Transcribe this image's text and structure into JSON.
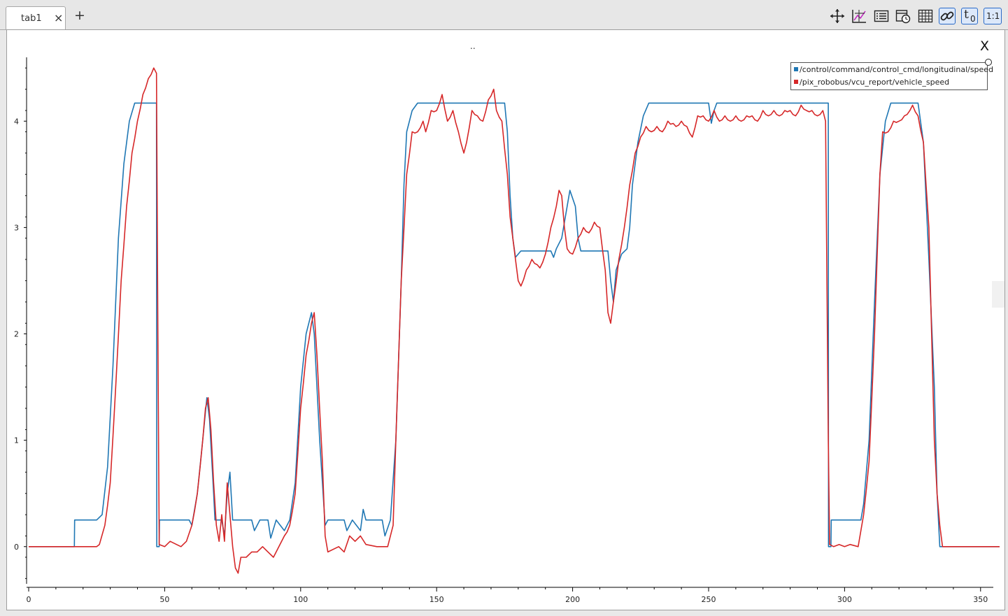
{
  "tabs": [
    {
      "label": "tab1"
    }
  ],
  "add_tab_label": "+",
  "tab_close_label": "×",
  "toolbar": {
    "icons": [
      "move-icon",
      "axis-scale-icon",
      "list-icon",
      "time-icon",
      "grid-icon",
      "link-icon",
      "t0-icon",
      "ratio-icon"
    ],
    "t0_label": "t",
    "t0_sub": "0",
    "ratio_label": "1:1"
  },
  "plot": {
    "title": "..",
    "close_label": "X"
  },
  "chart_data": {
    "type": "line",
    "xlim": [
      0,
      357
    ],
    "ylim": [
      -0.35,
      4.6
    ],
    "xticks": [
      0,
      50,
      100,
      150,
      200,
      250,
      300,
      350
    ],
    "yticks": [
      0,
      1,
      2,
      3,
      4
    ],
    "grid": false,
    "legend_position": "top-right",
    "series": [
      {
        "name": "/control/command/control_cmd/longitudinal/speed",
        "color": "#1f77b4",
        "points": [
          [
            0,
            0
          ],
          [
            16.8,
            0
          ],
          [
            16.9,
            0.25
          ],
          [
            25,
            0.25
          ],
          [
            27,
            0.3
          ],
          [
            29,
            0.75
          ],
          [
            31,
            1.7
          ],
          [
            33,
            2.9
          ],
          [
            35,
            3.6
          ],
          [
            37,
            4.0
          ],
          [
            39,
            4.17
          ],
          [
            47,
            4.17
          ],
          [
            47.1,
            0
          ],
          [
            48,
            0
          ],
          [
            48.1,
            0.25
          ],
          [
            59,
            0.25
          ],
          [
            60,
            0.2
          ],
          [
            62,
            0.5
          ],
          [
            64,
            1.0
          ],
          [
            65.5,
            1.4
          ],
          [
            66.5,
            1.2
          ],
          [
            68,
            0.5
          ],
          [
            68.5,
            0.25
          ],
          [
            71,
            0.25
          ],
          [
            72,
            0.1
          ],
          [
            73,
            0.5
          ],
          [
            74,
            0.7
          ],
          [
            75,
            0.25
          ],
          [
            82,
            0.25
          ],
          [
            83,
            0.15
          ],
          [
            85,
            0.25
          ],
          [
            88,
            0.25
          ],
          [
            89,
            0.08
          ],
          [
            91,
            0.25
          ],
          [
            94,
            0.15
          ],
          [
            96,
            0.25
          ],
          [
            98,
            0.6
          ],
          [
            100,
            1.5
          ],
          [
            102,
            2.0
          ],
          [
            104,
            2.2
          ],
          [
            105,
            2.0
          ],
          [
            107,
            1.0
          ],
          [
            109,
            0.2
          ],
          [
            110,
            0.25
          ],
          [
            116,
            0.25
          ],
          [
            117,
            0.15
          ],
          [
            119,
            0.25
          ],
          [
            122,
            0.15
          ],
          [
            123,
            0.35
          ],
          [
            124,
            0.25
          ],
          [
            130,
            0.25
          ],
          [
            131,
            0.1
          ],
          [
            133,
            0.25
          ],
          [
            135,
            1.0
          ],
          [
            137,
            2.5
          ],
          [
            138,
            3.4
          ],
          [
            139,
            3.9
          ],
          [
            141,
            4.1
          ],
          [
            143,
            4.17
          ],
          [
            175,
            4.17
          ],
          [
            176,
            3.9
          ],
          [
            177,
            3.3
          ],
          [
            178,
            2.9
          ],
          [
            179,
            2.72
          ],
          [
            181,
            2.78
          ],
          [
            192,
            2.78
          ],
          [
            193,
            2.72
          ],
          [
            194,
            2.8
          ],
          [
            196,
            2.9
          ],
          [
            198,
            3.2
          ],
          [
            199,
            3.35
          ],
          [
            201,
            3.2
          ],
          [
            202,
            2.9
          ],
          [
            203,
            2.78
          ],
          [
            213,
            2.78
          ],
          [
            214,
            2.5
          ],
          [
            215,
            2.3
          ],
          [
            216,
            2.6
          ],
          [
            218,
            2.75
          ],
          [
            220,
            2.8
          ],
          [
            221,
            3.0
          ],
          [
            222,
            3.4
          ],
          [
            224,
            3.8
          ],
          [
            226,
            4.05
          ],
          [
            228,
            4.17
          ],
          [
            250,
            4.17
          ],
          [
            251,
            3.98
          ],
          [
            252,
            4.1
          ],
          [
            253,
            4.17
          ],
          [
            294,
            4.17
          ],
          [
            294.1,
            0
          ],
          [
            295,
            0
          ],
          [
            295.1,
            0.25
          ],
          [
            306,
            0.25
          ],
          [
            307,
            0.4
          ],
          [
            309,
            1.0
          ],
          [
            311,
            2.3
          ],
          [
            313,
            3.5
          ],
          [
            315,
            4.0
          ],
          [
            317,
            4.17
          ],
          [
            327,
            4.17
          ],
          [
            329,
            3.8
          ],
          [
            331,
            2.7
          ],
          [
            333,
            1.5
          ],
          [
            334,
            0.5
          ],
          [
            335,
            0
          ],
          [
            357,
            0
          ]
        ]
      },
      {
        "name": "/pix_robobus/vcu_report/vehicle_speed",
        "color": "#d62728",
        "points": [
          [
            0,
            0
          ],
          [
            25,
            0
          ],
          [
            26,
            0.02
          ],
          [
            28,
            0.2
          ],
          [
            30,
            0.6
          ],
          [
            32,
            1.5
          ],
          [
            34,
            2.5
          ],
          [
            36,
            3.2
          ],
          [
            38,
            3.7
          ],
          [
            40,
            4.0
          ],
          [
            42,
            4.25
          ],
          [
            44,
            4.4
          ],
          [
            46,
            4.5
          ],
          [
            47,
            4.45
          ],
          [
            47.5,
            2.0
          ],
          [
            48,
            0.02
          ],
          [
            50,
            0
          ],
          [
            52,
            0.05
          ],
          [
            56,
            0
          ],
          [
            58,
            0.05
          ],
          [
            60,
            0.2
          ],
          [
            62,
            0.5
          ],
          [
            64,
            1.0
          ],
          [
            65,
            1.3
          ],
          [
            66,
            1.4
          ],
          [
            67,
            1.1
          ],
          [
            68,
            0.6
          ],
          [
            69,
            0.2
          ],
          [
            70,
            0.05
          ],
          [
            71,
            0.3
          ],
          [
            72,
            0.05
          ],
          [
            73,
            0.6
          ],
          [
            74,
            0.3
          ],
          [
            75,
            0
          ],
          [
            76,
            -0.2
          ],
          [
            77,
            -0.25
          ],
          [
            78,
            -0.1
          ],
          [
            80,
            -0.1
          ],
          [
            82,
            -0.05
          ],
          [
            84,
            -0.05
          ],
          [
            86,
            0
          ],
          [
            88,
            -0.05
          ],
          [
            90,
            -0.1
          ],
          [
            92,
            0
          ],
          [
            94,
            0.1
          ],
          [
            96,
            0.2
          ],
          [
            98,
            0.5
          ],
          [
            100,
            1.3
          ],
          [
            102,
            1.8
          ],
          [
            104,
            2.1
          ],
          [
            105,
            2.2
          ],
          [
            106,
            1.8
          ],
          [
            108,
            0.8
          ],
          [
            109,
            0.1
          ],
          [
            110,
            -0.05
          ],
          [
            114,
            0
          ],
          [
            116,
            -0.05
          ],
          [
            118,
            0.1
          ],
          [
            120,
            0.05
          ],
          [
            122,
            0.1
          ],
          [
            124,
            0.02
          ],
          [
            128,
            0
          ],
          [
            132,
            0
          ],
          [
            134,
            0.2
          ],
          [
            135,
            1.0
          ],
          [
            137,
            2.5
          ],
          [
            139,
            3.5
          ],
          [
            141,
            3.9
          ],
          [
            143,
            3.9
          ],
          [
            145,
            4.0
          ],
          [
            146,
            3.9
          ],
          [
            148,
            4.1
          ],
          [
            150,
            4.1
          ],
          [
            152,
            4.25
          ],
          [
            154,
            4.0
          ],
          [
            156,
            4.1
          ],
          [
            158,
            3.9
          ],
          [
            160,
            3.7
          ],
          [
            161,
            3.8
          ],
          [
            163,
            4.1
          ],
          [
            165,
            4.05
          ],
          [
            167,
            4.0
          ],
          [
            169,
            4.2
          ],
          [
            171,
            4.3
          ],
          [
            172,
            4.1
          ],
          [
            174,
            4.0
          ],
          [
            176,
            3.5
          ],
          [
            177,
            3.1
          ],
          [
            178,
            2.9
          ],
          [
            179,
            2.7
          ],
          [
            180,
            2.5
          ],
          [
            181,
            2.45
          ],
          [
            183,
            2.6
          ],
          [
            185,
            2.7
          ],
          [
            187,
            2.65
          ],
          [
            188,
            2.62
          ],
          [
            190,
            2.75
          ],
          [
            192,
            3.0
          ],
          [
            194,
            3.2
          ],
          [
            195,
            3.35
          ],
          [
            196,
            3.3
          ],
          [
            197,
            3.0
          ],
          [
            198,
            2.8
          ],
          [
            200,
            2.75
          ],
          [
            202,
            2.9
          ],
          [
            204,
            3.0
          ],
          [
            206,
            2.95
          ],
          [
            208,
            3.05
          ],
          [
            210,
            3.0
          ],
          [
            212,
            2.6
          ],
          [
            213,
            2.2
          ],
          [
            214,
            2.1
          ],
          [
            215,
            2.3
          ],
          [
            217,
            2.7
          ],
          [
            219,
            3.0
          ],
          [
            221,
            3.4
          ],
          [
            223,
            3.7
          ],
          [
            225,
            3.85
          ],
          [
            227,
            3.95
          ],
          [
            229,
            3.9
          ],
          [
            231,
            3.95
          ],
          [
            233,
            3.9
          ],
          [
            235,
            4.0
          ],
          [
            238,
            3.95
          ],
          [
            240,
            4.0
          ],
          [
            242,
            3.95
          ],
          [
            244,
            3.85
          ],
          [
            246,
            4.05
          ],
          [
            248,
            4.05
          ],
          [
            250,
            4.0
          ],
          [
            252,
            4.1
          ],
          [
            254,
            4.0
          ],
          [
            256,
            4.05
          ],
          [
            258,
            4.0
          ],
          [
            260,
            4.05
          ],
          [
            262,
            4.0
          ],
          [
            264,
            4.05
          ],
          [
            266,
            4.05
          ],
          [
            268,
            4.0
          ],
          [
            270,
            4.1
          ],
          [
            272,
            4.05
          ],
          [
            274,
            4.1
          ],
          [
            276,
            4.05
          ],
          [
            278,
            4.1
          ],
          [
            280,
            4.1
          ],
          [
            282,
            4.05
          ],
          [
            284,
            4.15
          ],
          [
            286,
            4.1
          ],
          [
            288,
            4.1
          ],
          [
            290,
            4.05
          ],
          [
            292,
            4.1
          ],
          [
            293,
            4.0
          ],
          [
            294,
            1.0
          ],
          [
            294.5,
            0.02
          ],
          [
            296,
            0
          ],
          [
            298,
            0.02
          ],
          [
            300,
            0
          ],
          [
            302,
            0.02
          ],
          [
            305,
            0
          ],
          [
            307,
            0.3
          ],
          [
            309,
            0.8
          ],
          [
            311,
            2.0
          ],
          [
            313,
            3.5
          ],
          [
            314,
            3.9
          ],
          [
            316,
            3.9
          ],
          [
            318,
            4.0
          ],
          [
            320,
            4.0
          ],
          [
            322,
            4.05
          ],
          [
            324,
            4.1
          ],
          [
            325,
            4.15
          ],
          [
            327,
            4.05
          ],
          [
            329,
            3.8
          ],
          [
            331,
            3.0
          ],
          [
            332,
            2.0
          ],
          [
            333,
            1.0
          ],
          [
            334,
            0.5
          ],
          [
            335,
            0.2
          ],
          [
            336,
            0
          ],
          [
            357,
            0
          ]
        ]
      }
    ]
  }
}
